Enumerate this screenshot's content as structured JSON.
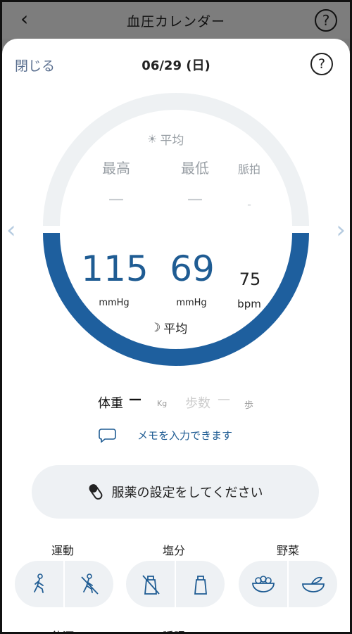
{
  "header": {
    "title": "血圧カレンダー",
    "help": "?"
  },
  "sheet": {
    "close_label": "閉じる",
    "date": "06/29 (日)",
    "help": "?"
  },
  "morning": {
    "label": "平均",
    "max_label": "最高",
    "min_label": "最低",
    "pulse_label": "脈拍",
    "max": "—",
    "min": "—",
    "pulse": "-"
  },
  "evening": {
    "label": "平均",
    "max": "115",
    "min": "69",
    "pulse": "75",
    "max_unit": "mmHg",
    "min_unit": "mmHg",
    "pulse_unit": "bpm"
  },
  "weight": {
    "label": "体重",
    "value": "—",
    "unit": "Kg"
  },
  "steps": {
    "label": "歩数",
    "value": "—",
    "unit": "歩"
  },
  "memo": {
    "placeholder": "メモを入力できます"
  },
  "medication": {
    "label": "服薬の設定をしてください"
  },
  "categories": {
    "exercise": "運動",
    "salt": "塩分",
    "vegetables": "野菜",
    "drinking": "飲酒",
    "sleep": "睡眠"
  },
  "colors": {
    "accent": "#1f5c93",
    "ring_top": "#eef1f3",
    "ring_bottom": "#1e5f9e"
  }
}
